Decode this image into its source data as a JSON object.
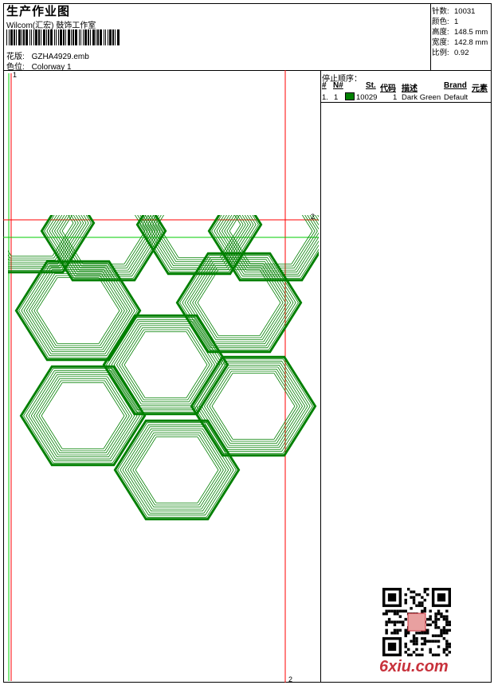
{
  "header": {
    "title": "生产作业图",
    "studio": "Wilcom(汇宏) 鼓饰工作室",
    "design_label": "花版:",
    "design_value": "GZHA4929.emb",
    "colorway_label": "色位:",
    "colorway_value": "Colorway 1"
  },
  "stats": [
    {
      "label": "针数:",
      "value": "10031"
    },
    {
      "label": "颜色:",
      "value": "1"
    },
    {
      "label": "高度:",
      "value": "148.5 mm"
    },
    {
      "label": "宽度:",
      "value": "142.8 mm"
    },
    {
      "label": "比例:",
      "value": "0.92"
    }
  ],
  "sequence": {
    "title": "停止顺序：",
    "columns": [
      "#",
      "N#",
      "St.",
      "代码",
      "描述",
      "Brand",
      "元素"
    ],
    "rows": [
      {
        "num": "1.",
        "needle": "1",
        "code": "10029",
        "stops": "1",
        "description": "Dark Green",
        "brand": "Default",
        "color": "#008000"
      }
    ]
  },
  "canvas": {
    "marker_top": "1",
    "marker_right": "2",
    "marker_bottom": "2",
    "stitch_color": "#008000",
    "guide_red": "#ff0000",
    "guide_green": "#00cc00"
  },
  "watermark": "6xiu.com"
}
